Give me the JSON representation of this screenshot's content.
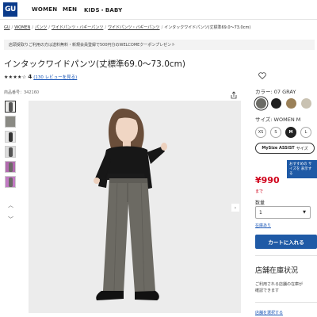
{
  "header": {
    "logo": "GU",
    "nav": [
      "WOMEN",
      "MEN",
      "KIDS・BABY"
    ]
  },
  "breadcrumb": {
    "items": [
      "GU",
      "WOMEN",
      "パンツ",
      "ワイドパンツ・バギーパンツ",
      "ワイドパンツ・バギーパンツ"
    ],
    "current": "インタックワイドパンツ(丈標準69.0〜73.0cm)"
  },
  "banner": {
    "text": "店頭受取りご利用の方は送料無料・新規会員登録で500円分のWELCOMEクーポンプレゼント"
  },
  "product": {
    "title": "インタックワイドパンツ(丈標準69.0〜73.0cm)",
    "stars": "★★★★☆",
    "rating": "4",
    "review_link": "(130 レビューを見る)",
    "item_no": "商品番号：342160",
    "price": "¥990",
    "price_note": "まで"
  },
  "options": {
    "color_label": "カラー: 07 GRAY",
    "colors": [
      "#6b6b66",
      "#1f1f1f",
      "#9a8058",
      "#c9c2b2"
    ],
    "size_label": "サイズ: WOMEN M",
    "sizes": [
      "XS",
      "S",
      "M",
      "L"
    ],
    "selected_size": "M",
    "mysize_label": "MySize ASSIST",
    "mysize_sub": "サイズ",
    "promo": "おすすめの サイズを 表示する"
  },
  "quantity": {
    "label": "数量",
    "value": "1",
    "stock_link": "在庫あり"
  },
  "cart": {
    "button": "カートに入れる"
  },
  "store": {
    "title": "店舗在庫状況",
    "desc1": "ご利用される店舗の在庫が",
    "desc2": "確認できます",
    "link": "店舗を選択する"
  },
  "icons": {
    "favorite": "heart-icon",
    "share": "share-icon"
  },
  "colors": {
    "accent": "#1f5aa6",
    "price": "#d0021b"
  }
}
